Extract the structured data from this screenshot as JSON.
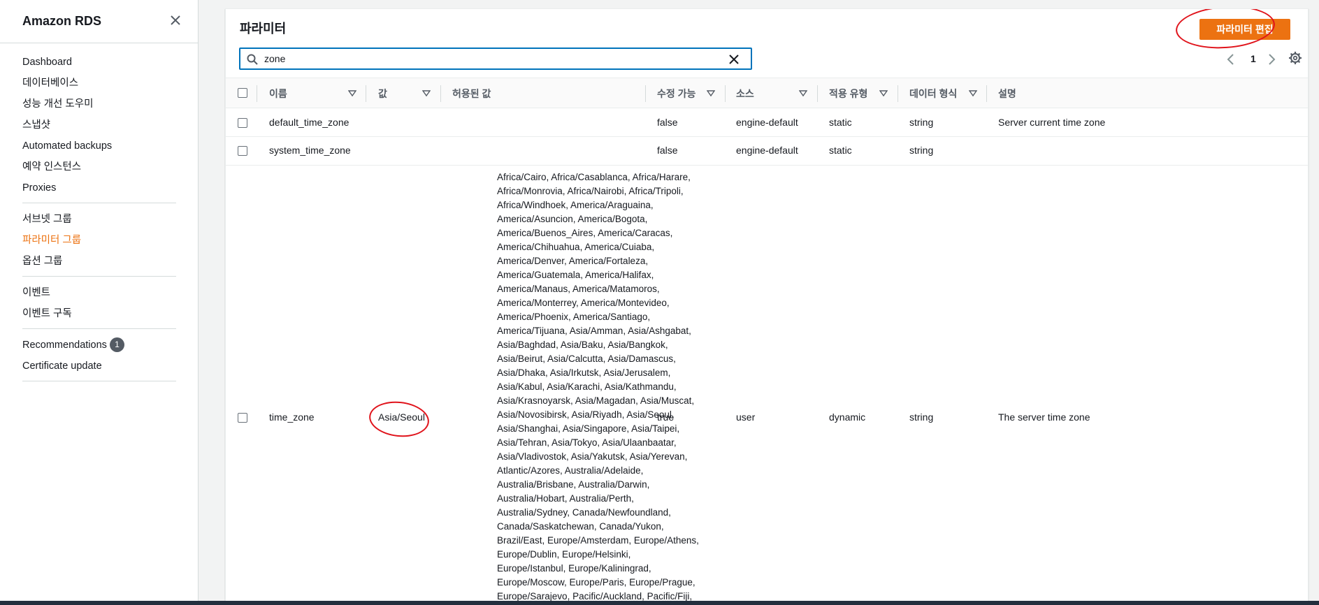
{
  "sidebar": {
    "title": "Amazon RDS",
    "groups": [
      [
        "Dashboard",
        "데이터베이스",
        "성능 개선 도우미",
        "스냅샷",
        "Automated backups",
        "예약 인스턴스",
        "Proxies"
      ],
      [
        "서브넷 그룹",
        "파라미터 그룹",
        "옵션 그룹"
      ],
      [
        "이벤트",
        "이벤트 구독"
      ]
    ],
    "recommendations_label": "Recommendations",
    "recommendations_count": "1",
    "certificate_label": "Certificate update"
  },
  "panel": {
    "title": "파라미터",
    "edit_button": "파라미터 편집",
    "search_value": "zone",
    "page_number": "1"
  },
  "table": {
    "headers": {
      "name": "이름",
      "value": "값",
      "allowed": "허용된 값",
      "modifiable": "수정 가능",
      "source": "소스",
      "apply_type": "적용 유형",
      "data_type": "데이터 형식",
      "description": "설명"
    },
    "rows": [
      {
        "name": "default_time_zone",
        "value": "",
        "modifiable": "false",
        "source": "engine-default",
        "apply_type": "static",
        "data_type": "string",
        "description": "Server current time zone"
      },
      {
        "name": "system_time_zone",
        "value": "",
        "modifiable": "false",
        "source": "engine-default",
        "apply_type": "static",
        "data_type": "string",
        "description": ""
      },
      {
        "name": "time_zone",
        "value": "Asia/Seoul",
        "modifiable": "true",
        "source": "user",
        "apply_type": "dynamic",
        "data_type": "string",
        "description": "The server time zone"
      }
    ],
    "allowed_lines": [
      "Africa/Cairo, Africa/Casablanca, Africa/Harare,",
      "Africa/Monrovia, Africa/Nairobi, Africa/Tripoli,",
      "Africa/Windhoek, America/Araguaina,",
      "America/Asuncion, America/Bogota,",
      "America/Buenos_Aires, America/Caracas,",
      "America/Chihuahua, America/Cuiaba,",
      "America/Denver, America/Fortaleza,",
      "America/Guatemala, America/Halifax,",
      "America/Manaus, America/Matamoros,",
      "America/Monterrey, America/Montevideo,",
      "America/Phoenix, America/Santiago,",
      "America/Tijuana, Asia/Amman, Asia/Ashgabat,",
      "Asia/Baghdad, Asia/Baku, Asia/Bangkok,",
      "Asia/Beirut, Asia/Calcutta, Asia/Damascus,",
      "Asia/Dhaka, Asia/Irkutsk, Asia/Jerusalem,",
      "Asia/Kabul, Asia/Karachi, Asia/Kathmandu,",
      "Asia/Krasnoyarsk, Asia/Magadan, Asia/Muscat,",
      "Asia/Novosibirsk, Asia/Riyadh, Asia/Seoul,",
      "Asia/Shanghai, Asia/Singapore, Asia/Taipei,",
      "Asia/Tehran, Asia/Tokyo, Asia/Ulaanbaatar,",
      "Asia/Vladivostok, Asia/Yakutsk, Asia/Yerevan,",
      "Atlantic/Azores, Australia/Adelaide,",
      "Australia/Brisbane, Australia/Darwin,",
      "Australia/Hobart, Australia/Perth,",
      "Australia/Sydney, Canada/Newfoundland,",
      "Canada/Saskatchewan, Canada/Yukon,",
      "Brazil/East, Europe/Amsterdam, Europe/Athens,",
      "Europe/Dublin, Europe/Helsinki,",
      "Europe/Istanbul, Europe/Kaliningrad,",
      "Europe/Moscow, Europe/Paris, Europe/Prague,",
      "Europe/Sarajevo, Pacific/Auckland, Pacific/Fiji,"
    ]
  },
  "icons": {
    "close": "close-icon",
    "search": "search-icon",
    "clear": "clear-icon",
    "prev": "chevron-left-icon",
    "next": "chevron-right-icon",
    "settings": "gear-icon",
    "sort": "sort-down-icon"
  },
  "colors": {
    "accent": "#ec7211",
    "focus": "#0073bb",
    "annotation": "#e0131b"
  }
}
